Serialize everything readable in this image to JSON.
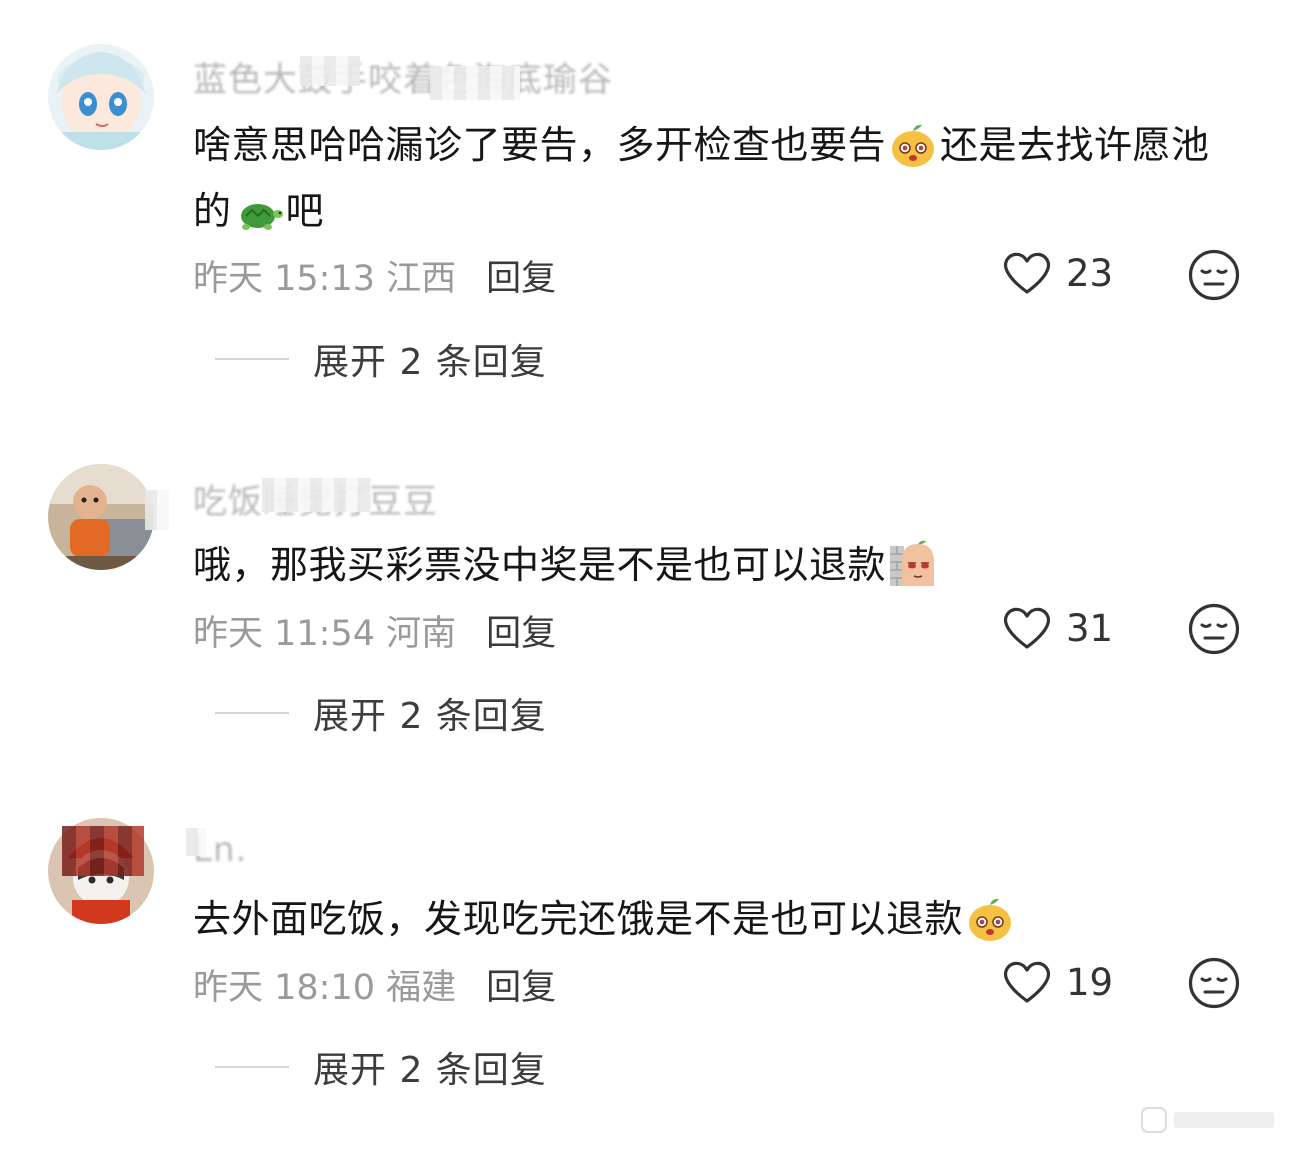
{
  "comments": [
    {
      "username": "蓝色大鼓手咬着色海底瑜谷",
      "text_parts": [
        "啥意思哈哈漏诊了要告，多开检查也要告",
        "还是去找许愿池的",
        "吧"
      ],
      "emojis": [
        "bean-smile-emoji",
        "turtle-emoji"
      ],
      "time_location": "昨天 15:13 江西",
      "reply_label": "回复",
      "likes": "23",
      "expand_label": "展开 2 条回复"
    },
    {
      "username": "吃饭睡觉打豆豆",
      "text_parts": [
        "哦，那我买彩票没中奖是不是也可以退款"
      ],
      "emojis": [
        "peek-wall-emoji"
      ],
      "time_location": "昨天 11:54 河南",
      "reply_label": "回复",
      "likes": "31",
      "expand_label": "展开 2 条回复"
    },
    {
      "username": "Ln.",
      "text_parts": [
        "去外面吃饭，发现吃完还饿是不是也可以退款"
      ],
      "emojis": [
        "bean-smile-emoji"
      ],
      "time_location": "昨天 18:10 福建",
      "reply_label": "回复",
      "likes": "19",
      "expand_label": "展开 2 条回复"
    }
  ],
  "icons": {
    "like": "heart-outline-icon",
    "dislike": "meh-face-icon"
  },
  "colors": {
    "text": "#161616",
    "meta": "#9a9a9a",
    "username": "#b8b8b8"
  }
}
